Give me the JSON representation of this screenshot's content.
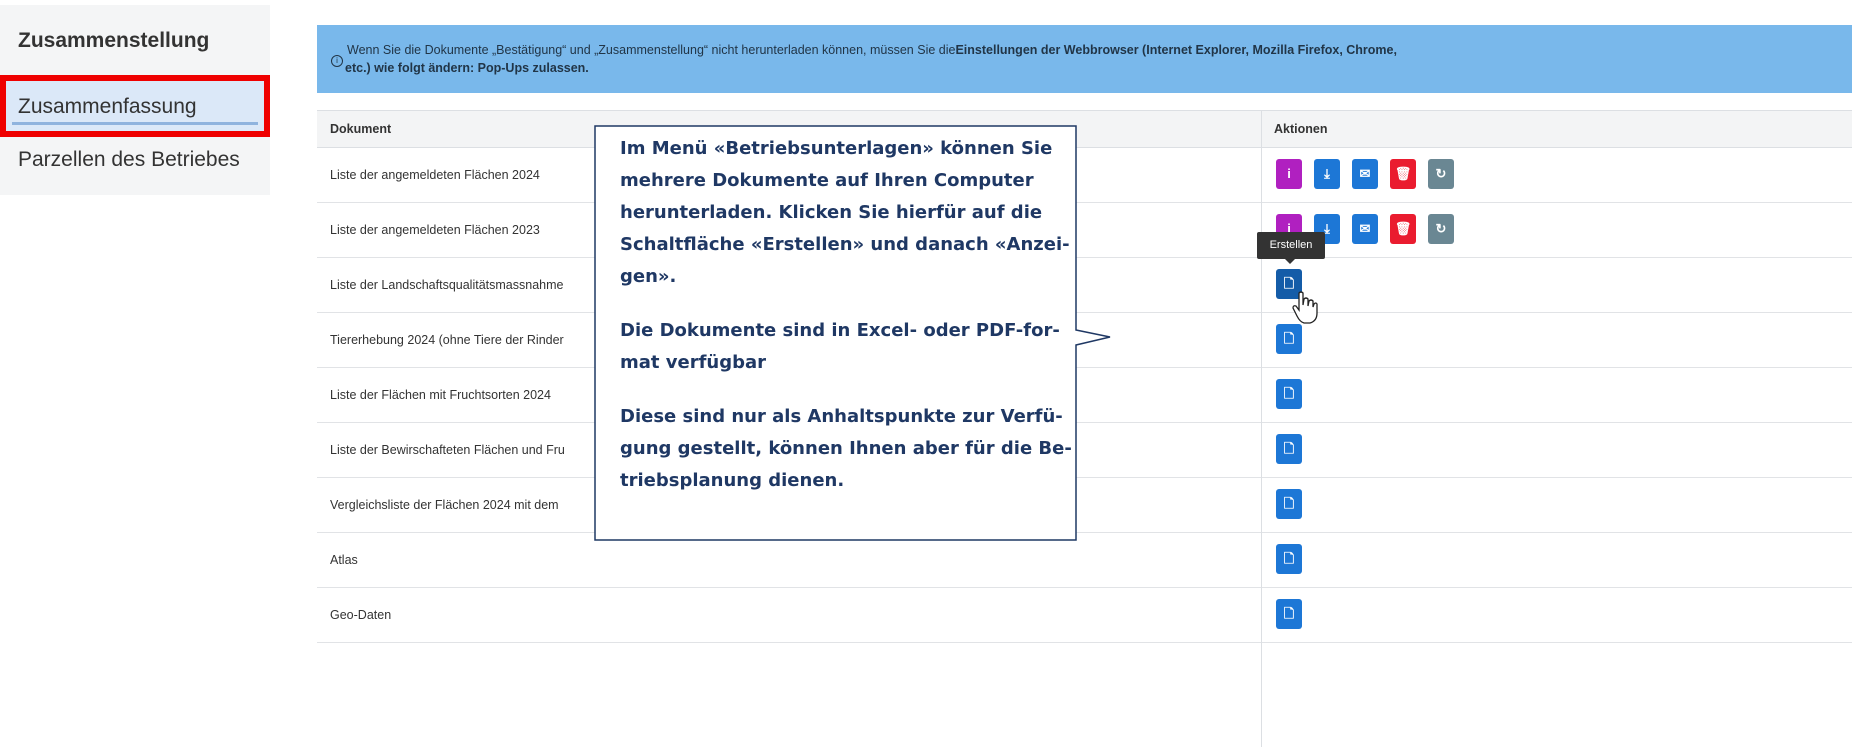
{
  "sidebar": {
    "title": "Zusammenstellung",
    "items": [
      {
        "label": "Zusammenfassung",
        "active": true
      },
      {
        "label": "Parzellen des Betriebes",
        "active": false
      }
    ]
  },
  "alert": {
    "line1_prefix": "Wenn Sie die Dokumente „Bestätigung“ und „Zusammenstellung“ nicht herunterladen können, müssen Sie die",
    "line1_bold": "Einstellungen der Webbrowser (Internet Explorer, Mozilla Firefox, Chrome,",
    "line2": "etc.) wie folgt ändern: Pop-Ups zulassen."
  },
  "table": {
    "columns": [
      "Dokument",
      "Aktionen"
    ],
    "rows": [
      {
        "document": "Liste der angemeldeten Flächen 2024",
        "actions": [
          "info",
          "download",
          "email",
          "delete",
          "refresh"
        ]
      },
      {
        "document": "Liste der angemeldeten Flächen 2023",
        "actions": [
          "info",
          "download",
          "email",
          "delete",
          "refresh"
        ]
      },
      {
        "document": "Liste der Landschaftsqualitätsmassnahme",
        "actions": [
          "create"
        ]
      },
      {
        "document": "Tiererhebung 2024 (ohne Tiere der Rinder",
        "actions": [
          "create"
        ]
      },
      {
        "document": "Liste der Flächen mit Fruchtsorten 2024",
        "actions": [
          "create"
        ]
      },
      {
        "document": "Liste der Bewirschafteten Flächen und Fru",
        "actions": [
          "create"
        ]
      },
      {
        "document": "Vergleichsliste der Flächen 2024 mit dem",
        "actions": [
          "create"
        ]
      },
      {
        "document": "Atlas",
        "actions": [
          "create"
        ]
      },
      {
        "document": "Geo-Daten",
        "actions": [
          "create"
        ]
      }
    ]
  },
  "tooltip": "Erstellen",
  "callout": {
    "paragraphs": [
      "Im Menü «Betriebsunterlagen» können Sie mehrere Dokumente auf Ihren Computer herunterladen. Klicken Sie hierfür auf die Schaltfläche «Erstellen» und danach «Anzei-gen».",
      "Die Dokumente sind in Excel- oder PDF-for-mat verfügbar",
      "Diese sind nur als Anhaltspunkte zur Verfü-gung gestellt, können Ihnen aber für die Be-triebsplanung dienen."
    ]
  },
  "colors": {
    "alert_bg": "#79b8eb",
    "highlight_border": "#ef0000",
    "info_button": "#b020c0",
    "primary_button": "#1d77d6",
    "delete_button": "#ea1c2f",
    "refresh_button": "#6a8793",
    "callout_text": "#1f3864"
  }
}
